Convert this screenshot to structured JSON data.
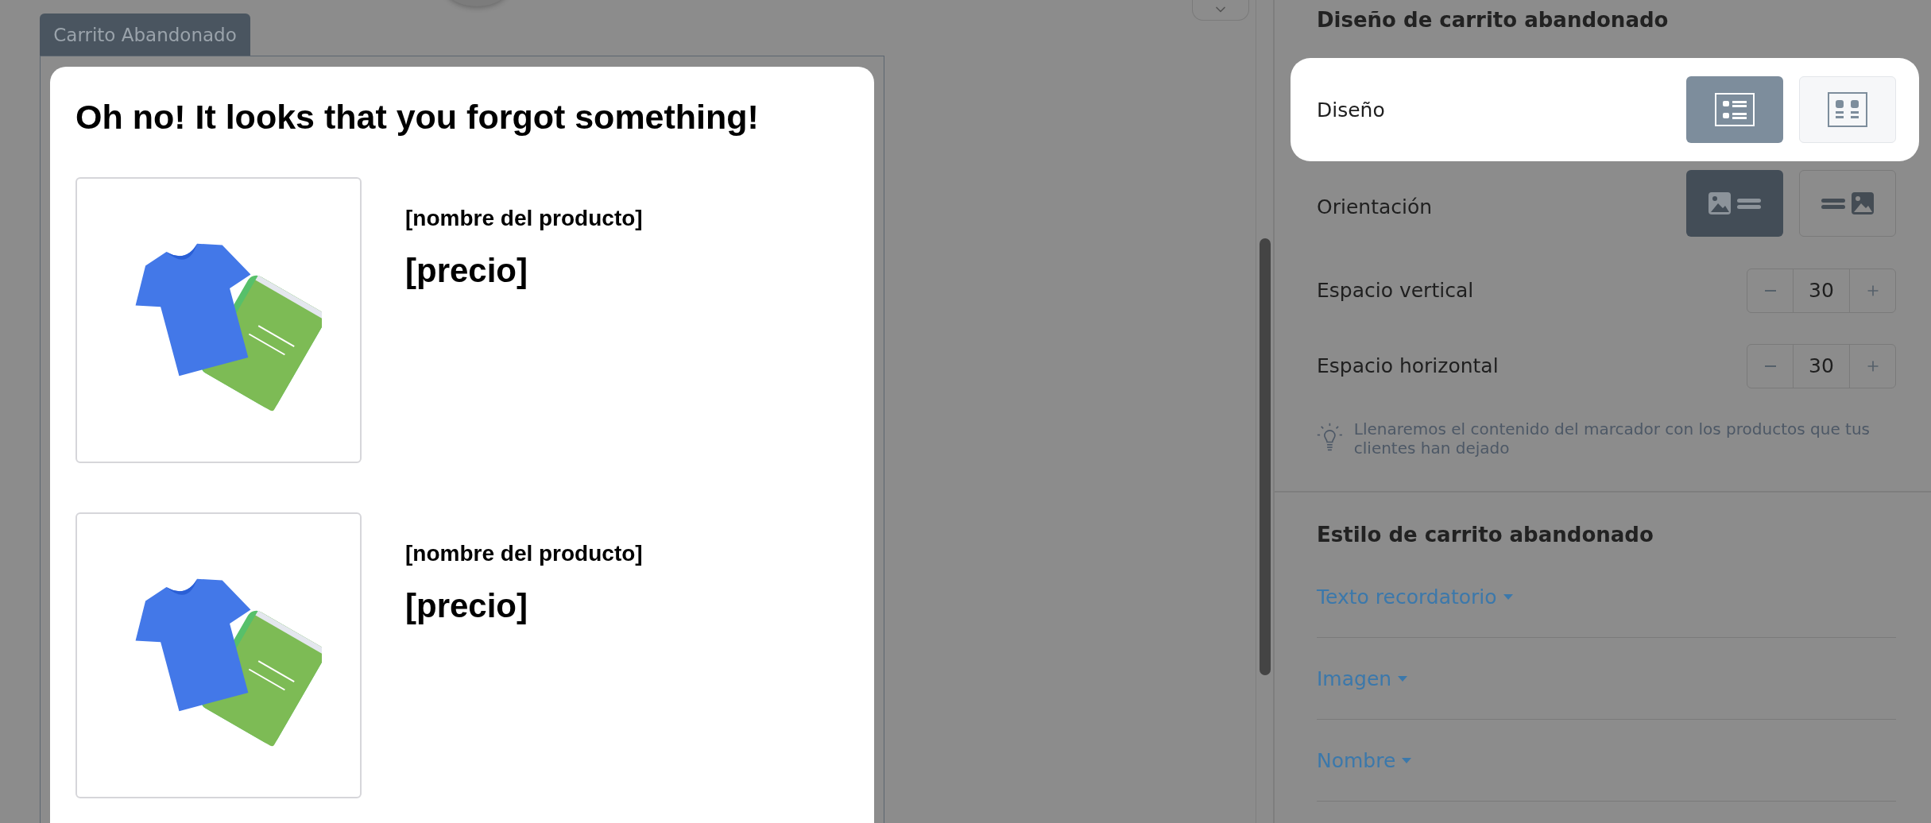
{
  "preview": {
    "tab": "Carrito Abandonado",
    "heading": "Oh no! It looks that you forgot something!",
    "products": [
      {
        "name": "[nombre del producto]",
        "price": "[precio]"
      },
      {
        "name": "[nombre del producto]",
        "price": "[precio]"
      }
    ]
  },
  "design_section": {
    "title": "Diseño de carrito abandonado",
    "rows": [
      {
        "kind": "choice",
        "label": "Diseño",
        "highlighted": true,
        "options": [
          {
            "selected": true
          },
          {
            "selected": false
          }
        ]
      },
      {
        "kind": "choice",
        "label": "Orientación",
        "highlighted": false,
        "options": [
          {
            "selected": true
          },
          {
            "selected": false
          }
        ]
      },
      {
        "kind": "stepper",
        "label": "Espacio vertical",
        "value": "30"
      },
      {
        "kind": "stepper",
        "label": "Espacio horizontal",
        "value": "30"
      }
    ],
    "tip": "Llenaremos el contenido del marcador con los productos que tus clientes han dejado"
  },
  "style_section": {
    "title": "Estilo de carrito abandonado",
    "items": [
      {
        "label": "Texto recordatorio"
      },
      {
        "label": "Imagen"
      },
      {
        "label": "Nombre"
      }
    ]
  }
}
